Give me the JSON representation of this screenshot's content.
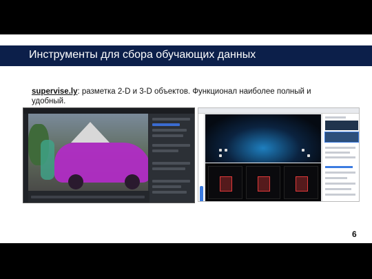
{
  "slide": {
    "title": "Инструменты для сбора обучающих данных",
    "body_link": "supervise.ly",
    "body_rest": ": разметка 2-D  и 3-D объектов. Функционал наиболее полный и удобный.",
    "page_number": "6"
  },
  "colors": {
    "title_bar": "#0c1f4a",
    "annotation_mask": "#b02cc4",
    "box_3d": "#e23a3a",
    "accent": "#3b7be0"
  }
}
